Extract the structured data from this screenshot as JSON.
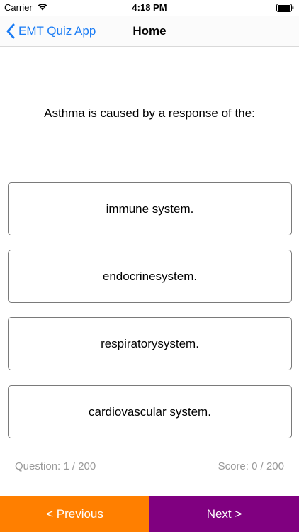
{
  "status_bar": {
    "carrier": "Carrier",
    "time": "4:18 PM",
    "icons": [
      "wifi-icon",
      "battery-icon"
    ]
  },
  "nav": {
    "back_label": "EMT Quiz App",
    "title": "Home",
    "accent_color": "#1a7cf5"
  },
  "quiz": {
    "question": "Asthma is caused by a response of the:",
    "answers": [
      "immune system.",
      "endocrinesystem.",
      "respiratorysystem.",
      "cardiovascular system."
    ],
    "question_counter": "Question: 1 / 200",
    "score": "Score: 0 / 200"
  },
  "footer": {
    "previous_label": "< Previous",
    "next_label": "Next >",
    "previous_color": "#ff7f00",
    "next_color": "#800080"
  }
}
